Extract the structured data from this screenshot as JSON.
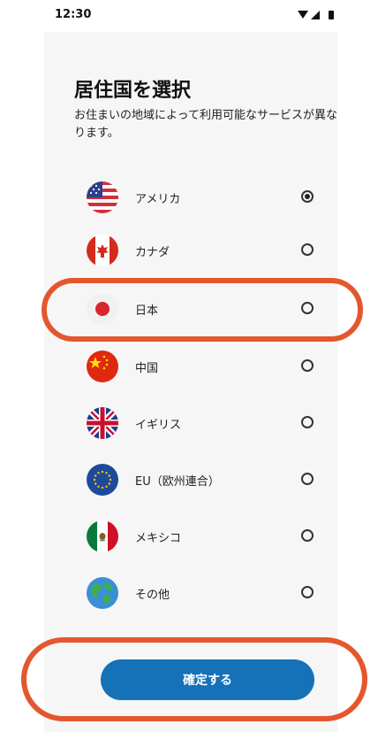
{
  "status": {
    "time": "12:30",
    "icons": [
      "wifi-icon",
      "cellular-icon",
      "battery-icon"
    ]
  },
  "page": {
    "title": "居住国を選択",
    "subtitle": "お住まいの地域によって利用可能なサービスが異なります。"
  },
  "countries": [
    {
      "label": "アメリカ",
      "flag": "us-flag-icon",
      "selected": true
    },
    {
      "label": "カナダ",
      "flag": "canada-flag-icon",
      "selected": false
    },
    {
      "label": "日本",
      "flag": "japan-flag-icon",
      "selected": false
    },
    {
      "label": "中国",
      "flag": "china-flag-icon",
      "selected": false
    },
    {
      "label": "イギリス",
      "flag": "uk-flag-icon",
      "selected": false
    },
    {
      "label": "EU（欧州連合）",
      "flag": "eu-flag-icon",
      "selected": false
    },
    {
      "label": "メキシコ",
      "flag": "mexico-flag-icon",
      "selected": false
    },
    {
      "label": "その他",
      "flag": "globe-icon",
      "selected": false
    }
  ],
  "confirm_button": {
    "label": "確定する",
    "color": "#1572b8"
  },
  "annotation_color": "#e4572e"
}
